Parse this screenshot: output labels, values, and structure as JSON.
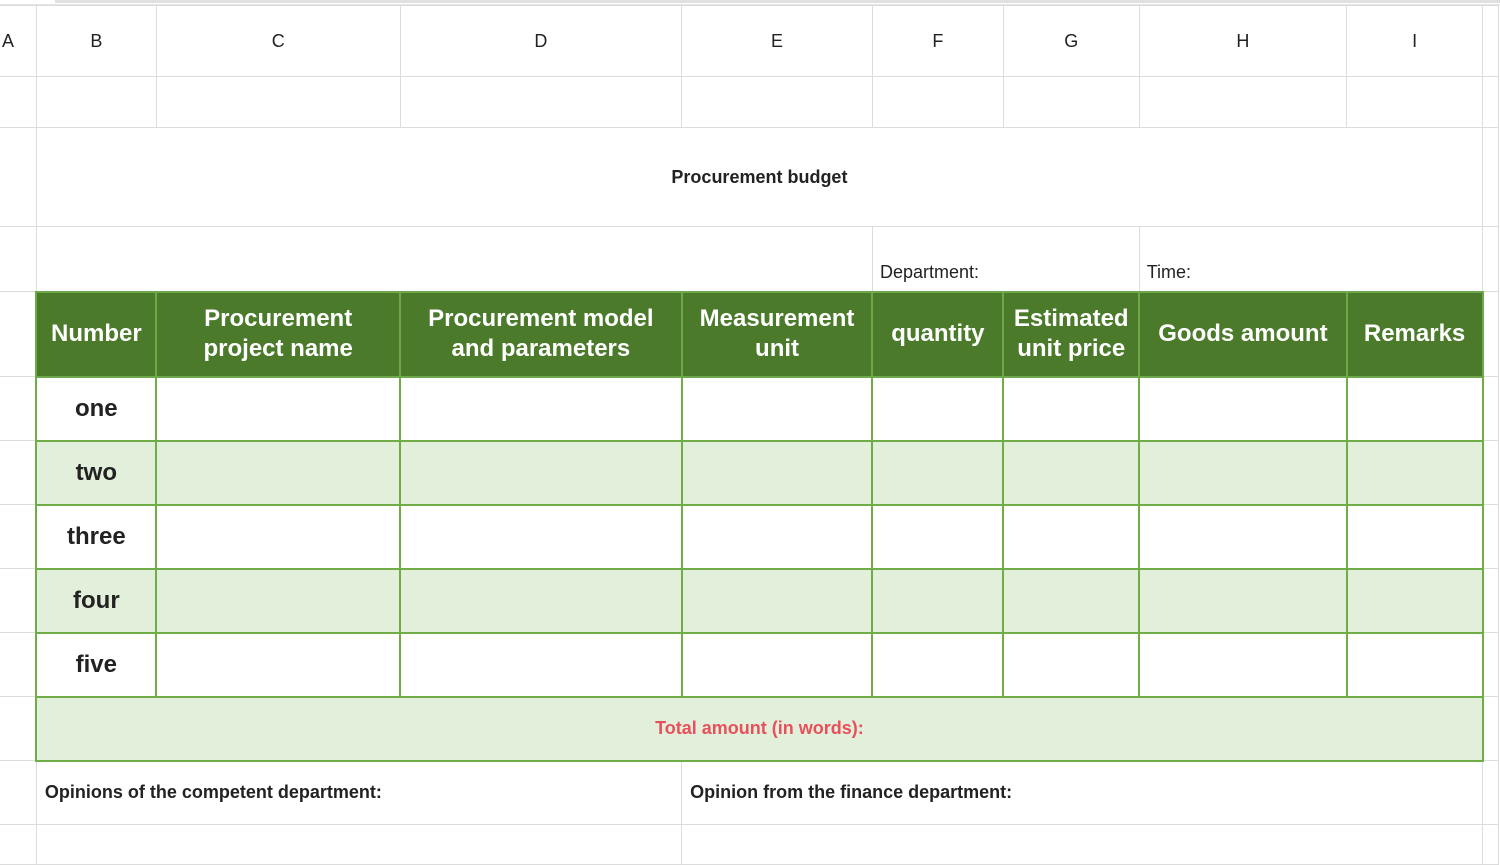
{
  "columns": [
    "A",
    "B",
    "C",
    "D",
    "E",
    "F",
    "G",
    "H",
    "I"
  ],
  "title": "Procurement budget",
  "meta": {
    "department_label": "Department:",
    "time_label": "Time:"
  },
  "table_headers": [
    "Number",
    "Procurement project name",
    "Procurement model and parameters",
    "Measurement unit",
    "quantity",
    "Estimated unit price",
    "Goods amount",
    "Remarks"
  ],
  "rows": [
    "one",
    "two",
    "three",
    "four",
    "five"
  ],
  "total_label": "Total amount (in words):",
  "opinions": {
    "competent": "Opinions of the competent department:",
    "finance": "Opinion from the finance department:"
  },
  "colors": {
    "header_bg": "#4a7a2a",
    "band_bg": "#e2efda",
    "border_green": "#70ad47",
    "total_text": "#e8505b"
  }
}
